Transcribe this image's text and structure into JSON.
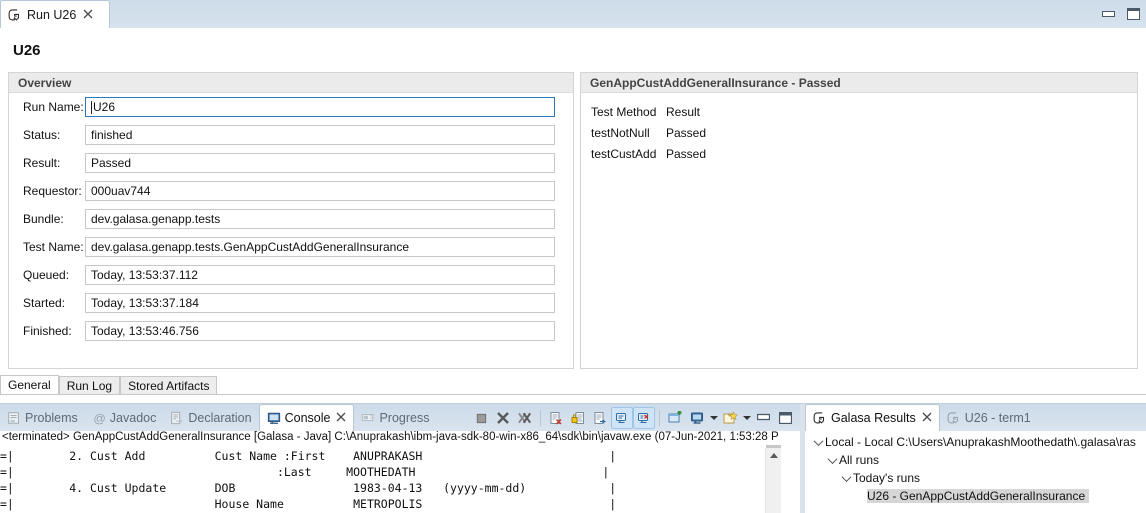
{
  "editor": {
    "tab": {
      "title": "Run U26",
      "icon": "galasa-logo-icon",
      "close": "✕"
    },
    "window_buttons": {
      "minimize": "minimize-icon",
      "maximize": "maximize-icon"
    },
    "page_title": "U26",
    "overview": {
      "header": "Overview",
      "fields": [
        {
          "label": "Run Name:",
          "value": "U26",
          "focused": true
        },
        {
          "label": "Status:",
          "value": "finished",
          "focused": false
        },
        {
          "label": "Result:",
          "value": "Passed",
          "focused": false
        },
        {
          "label": "Requestor:",
          "value": "000uav744",
          "focused": false
        },
        {
          "label": "Bundle:",
          "value": "dev.galasa.genapp.tests",
          "focused": false
        },
        {
          "label": "Test Name:",
          "value": "dev.galasa.genapp.tests.GenAppCustAddGeneralInsurance",
          "focused": false
        },
        {
          "label": "Queued:",
          "value": "Today, 13:53:37.112",
          "focused": false
        },
        {
          "label": "Started:",
          "value": "Today, 13:53:37.184",
          "focused": false
        },
        {
          "label": "Finished:",
          "value": "Today, 13:53:46.756",
          "focused": false
        }
      ]
    },
    "methods": {
      "header": "GenAppCustAddGeneralInsurance - Passed",
      "columns": [
        "Test Method",
        "Result"
      ],
      "rows": [
        {
          "method": "testNotNull",
          "result": "Passed"
        },
        {
          "method": "testCustAdd",
          "result": "Passed"
        }
      ]
    },
    "folder_tabs": [
      {
        "label": "General",
        "active": true
      },
      {
        "label": "Run Log",
        "active": false
      },
      {
        "label": "Stored Artifacts",
        "active": false
      }
    ]
  },
  "console_view": {
    "tabs": [
      {
        "label": "Problems",
        "icon": "problems-icon",
        "active": false
      },
      {
        "label": "Javadoc",
        "icon": "javadoc-icon",
        "active": false
      },
      {
        "label": "Declaration",
        "icon": "declaration-icon",
        "active": false
      },
      {
        "label": "Console",
        "icon": "console-icon",
        "active": true
      },
      {
        "label": "Progress",
        "icon": "progress-icon",
        "active": false
      }
    ],
    "toolbar": [
      {
        "name": "terminate-button",
        "toggled": false
      },
      {
        "name": "remove-launch-button",
        "toggled": false
      },
      {
        "name": "remove-all-terminated-button",
        "toggled": false
      },
      {
        "name": "clear-console-button",
        "toggled": false
      },
      {
        "name": "scroll-lock-button",
        "toggled": false
      },
      {
        "name": "word-wrap-button",
        "toggled": false
      },
      {
        "name": "show-console-on-output-button",
        "toggled": true
      },
      {
        "name": "show-console-on-error-button",
        "toggled": true
      },
      {
        "name": "pin-console-button",
        "toggled": false
      },
      {
        "name": "display-selected-console-button",
        "toggled": false
      },
      {
        "name": "open-console-button",
        "toggled": false
      },
      {
        "name": "minimize-view-button",
        "toggled": false
      },
      {
        "name": "maximize-view-button",
        "toggled": false
      }
    ],
    "header_line": "<terminated> GenAppCustAddGeneralInsurance [Galasa - Java] C:\\Anuprakash\\ibm-java-sdk-80-win-x86_64\\sdk\\bin\\javaw.exe (07-Jun-2021, 1:53:28 P",
    "lines": [
      "=|        2. Cust Add          Cust Name :First    ANUPRAKASH                           |",
      "=|                                      :Last     MOOTHEDATH                           |",
      "=|        4. Cust Update       DOB                 1983-04-13   (yyyy-mm-dd)            |",
      "=|                             House Name          METROPOLIS                           |"
    ]
  },
  "results_view": {
    "tabs": [
      {
        "label": "Galasa Results",
        "icon": "galasa-logo-icon",
        "active": true
      },
      {
        "label": "U26 - term1",
        "icon": "galasa-logo-icon",
        "active": false
      }
    ],
    "tree": [
      {
        "label": "Local - Local C:\\Users\\AnuprakashMoothedath\\.galasa\\ras",
        "indent": 0,
        "expanded": true,
        "selected": false
      },
      {
        "label": "All runs",
        "indent": 1,
        "expanded": true,
        "selected": false
      },
      {
        "label": "Today's runs",
        "indent": 2,
        "expanded": true,
        "selected": false
      },
      {
        "label": "U26 - GenAppCustAddGeneralInsurance",
        "indent": 3,
        "expanded": false,
        "selected": true
      }
    ]
  },
  "colors": {
    "tab_gradient_top": "#ccdbe9",
    "accent_focus": "#2b77c0",
    "selection_gray": "#d6d6d6",
    "section_header_bg": "#ebebeb"
  }
}
